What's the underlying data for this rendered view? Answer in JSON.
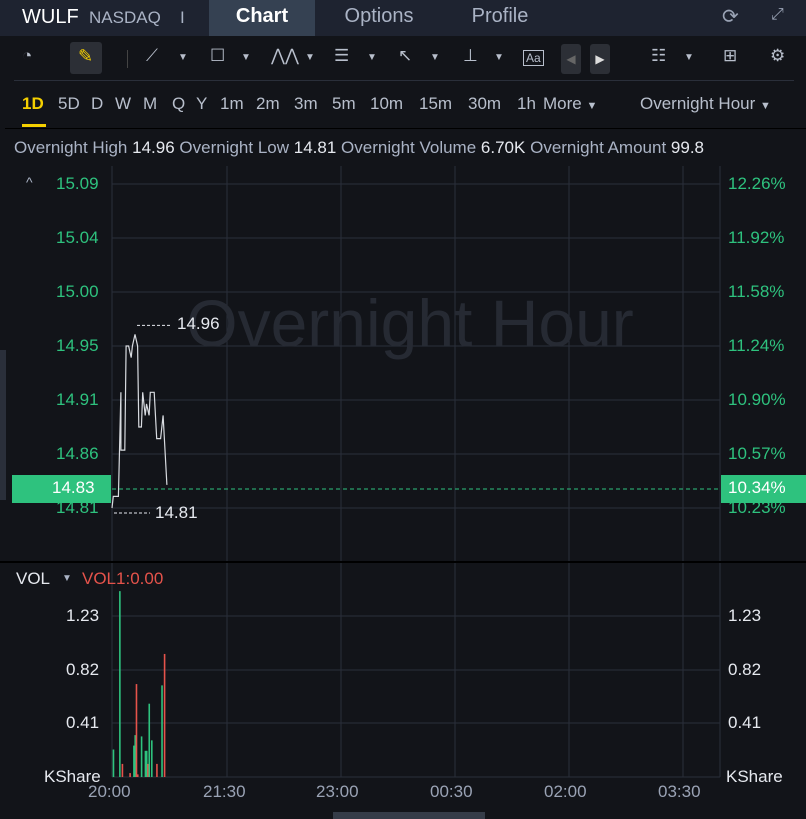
{
  "header": {
    "symbol": "WULF",
    "exchange": "NASDAQ",
    "divider": "I",
    "tabs": [
      {
        "label": "Chart",
        "active": true
      },
      {
        "label": "Options"
      },
      {
        "label": "Profile"
      }
    ],
    "icons": [
      "refresh-icon",
      "fullscreen-icon"
    ]
  },
  "toolbar": {
    "icons": [
      "gauge-icon",
      "draw-pencil-icon",
      "trend-line-icon",
      "rectangle-icon",
      "pattern-icon",
      "fibonacci-icon",
      "arrow-icon",
      "measure-icon",
      "text-note-icon",
      "prev-icon",
      "next-icon",
      "indicator-list-icon",
      "layout-grid-icon",
      "settings-icon"
    ]
  },
  "periods": {
    "items": [
      "1D",
      "5D",
      "D",
      "W",
      "M",
      "Q",
      "Y",
      "1m",
      "2m",
      "3m",
      "5m",
      "10m",
      "15m",
      "30m",
      "1h"
    ],
    "active": "1D",
    "more": "More",
    "session": "Overnight Hour"
  },
  "info": {
    "high_label": "Overnight High",
    "high": "14.96",
    "low_label": "Overnight Low",
    "low": "14.81",
    "volume_label": "Overnight Volume",
    "volume": "6.70K",
    "amount_label": "Overnight Amount",
    "amount": "99.8"
  },
  "watermark": "Overnight Hour",
  "colors": {
    "up": "#2ec27e",
    "down": "#e5534b",
    "accent": "#f5d000",
    "background": "#121419"
  },
  "chart_data": [
    {
      "type": "line",
      "title": "",
      "y_ticks_left": [
        "15.09",
        "15.04",
        "15.00",
        "14.95",
        "14.91",
        "14.86",
        "14.81"
      ],
      "y_ticks_right": [
        "12.26%",
        "11.92%",
        "11.58%",
        "11.24%",
        "10.90%",
        "10.57%",
        "10.23%"
      ],
      "ylim": [
        14.81,
        15.09
      ],
      "x_ticks": [
        "20:00",
        "21:30",
        "23:00",
        "00:30",
        "02:00",
        "03:30"
      ],
      "current_price": "14.83",
      "current_change": "10.34%",
      "high_marker": "14.96",
      "low_marker": "14.81",
      "points": [
        [
          "20:00",
          14.81
        ],
        [
          "20:01",
          14.82
        ],
        [
          "20:05",
          14.82
        ],
        [
          "20:07",
          14.91
        ],
        [
          "20:07",
          14.86
        ],
        [
          "20:10",
          14.86
        ],
        [
          "20:11",
          14.95
        ],
        [
          "20:13",
          14.95
        ],
        [
          "20:15",
          14.94
        ],
        [
          "20:16",
          14.95
        ],
        [
          "20:18",
          14.96
        ],
        [
          "20:20",
          14.95
        ],
        [
          "20:21",
          14.88
        ],
        [
          "20:23",
          14.88
        ],
        [
          "20:24",
          14.91
        ],
        [
          "20:26",
          14.89
        ],
        [
          "20:27",
          14.9
        ],
        [
          "20:29",
          14.89
        ],
        [
          "20:30",
          14.91
        ],
        [
          "20:33",
          14.91
        ],
        [
          "20:35",
          14.87
        ],
        [
          "20:38",
          14.87
        ],
        [
          "20:40",
          14.89
        ],
        [
          "20:43",
          14.83
        ]
      ]
    },
    {
      "type": "bar",
      "label": "VOL",
      "indicator": "VOL1:0.00",
      "unit": "KShare",
      "y_ticks": [
        "1.23",
        "0.82",
        "0.41"
      ],
      "ylim": [
        0,
        1.23
      ],
      "bars": [
        [
          "20:01",
          0.21,
          "up"
        ],
        [
          "20:06",
          1.42,
          "up"
        ],
        [
          "20:08",
          0.1,
          "down"
        ],
        [
          "20:14",
          0.03,
          "down"
        ],
        [
          "20:17",
          0.24,
          "up"
        ],
        [
          "20:18",
          0.32,
          "up"
        ],
        [
          "20:19",
          0.71,
          "down"
        ],
        [
          "20:20",
          0.02,
          "down"
        ],
        [
          "20:23",
          0.31,
          "up"
        ],
        [
          "20:26",
          0.2,
          "up"
        ],
        [
          "20:27",
          0.2,
          "up"
        ],
        [
          "20:28",
          0.1,
          "down"
        ],
        [
          "20:29",
          0.56,
          "up"
        ],
        [
          "20:31",
          0.28,
          "up"
        ],
        [
          "20:35",
          0.1,
          "down"
        ],
        [
          "20:39",
          0.7,
          "up"
        ],
        [
          "20:41",
          0.94,
          "down"
        ]
      ]
    }
  ]
}
